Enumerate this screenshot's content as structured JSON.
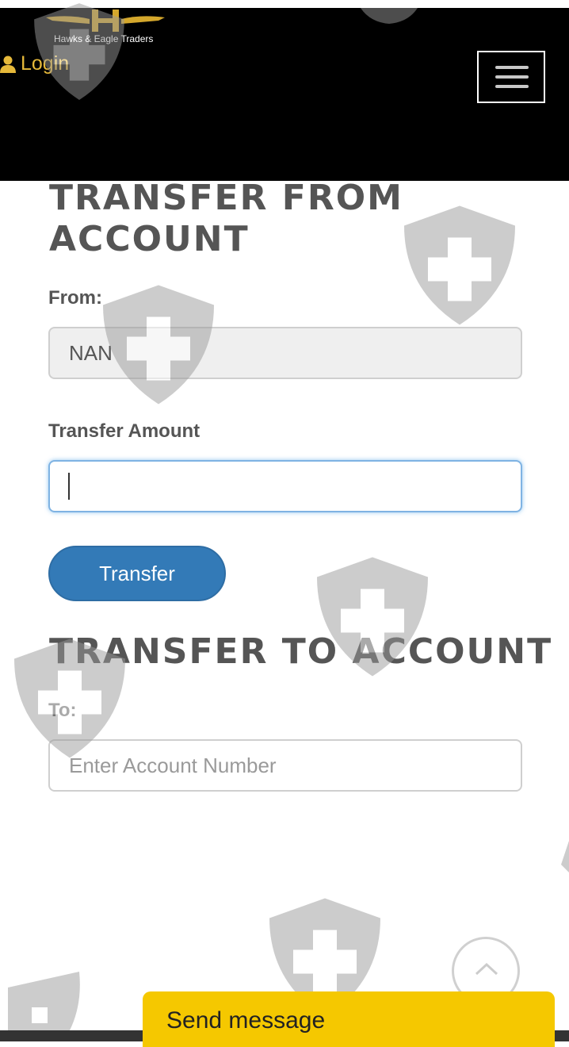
{
  "brand": {
    "name": "Hawks & Eagle Traders"
  },
  "header": {
    "login_label": "Login",
    "menu_icon": "hamburger-menu-icon"
  },
  "transfer_from": {
    "heading": "TRANSFER FROM ACCOUNT",
    "from_label": "From:",
    "from_value": "NAN",
    "amount_label": "Transfer Amount",
    "amount_value": "",
    "button_label": "Transfer"
  },
  "transfer_to": {
    "heading": "TRANSFER TO ACCOUNT",
    "to_label": "To:",
    "to_placeholder": "Enter Account Number"
  },
  "widgets": {
    "scroll_top_icon": "chevron-up-icon",
    "send_message_label": "Send message"
  },
  "colors": {
    "header_bg": "#000000",
    "accent_gold": "#e6b93a",
    "button_blue": "#337ab7",
    "chat_yellow": "#f5c800"
  }
}
